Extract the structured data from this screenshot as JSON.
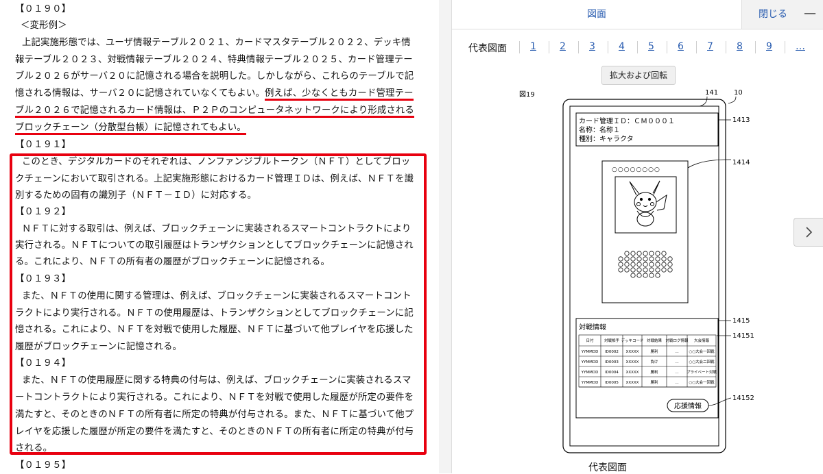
{
  "paragraphs": {
    "p0190": "【０１９０】",
    "p0190_head": "＜変形例＞",
    "p0190_l1": "上記実施形態では、ユーザ情報テーブル２０２１、カードマスタテーブル２０２２、デッキ情",
    "p0190_l2": "報テーブル２０２３、対戦情報テーブル２０２４、特典情報テーブル２０２５、カード管理テー",
    "p0190_l3": "ブル２０２６がサーバ２０に記憶される場合を説明した。しかしながら、これらのテーブルで記",
    "p0190_l4a": "憶される情報は、サーバ２０に記憶されていなくてもよい。",
    "p0190_l4b": "例えば、少なくともカード管理テー",
    "p0190_l5": "ブル２０２６で記憶されるカード情報は、Ｐ２Ｐのコンピュータネットワークにより形成される",
    "p0190_l6": "ブロックチェーン（分散型台帳）に記憶されてもよい。",
    "p0191": "【０１９１】",
    "p0191_l1": "このとき、デジタルカードのそれぞれは、ノンファンジブルトークン（ＮＦＴ）としてブロッ",
    "p0191_l2": "クチェーンにおいて取引される。上記実施形態におけるカード管理ＩＤは、例えば、ＮＦＴを識",
    "p0191_l3": "別するための固有の識別子（ＮＦＴ－ＩＤ）に対応する。",
    "p0192": "【０１９２】",
    "p0192_l1": "ＮＦＴに対する取引は、例えば、ブロックチェーンに実装されるスマートコントラクトにより",
    "p0192_l2": "実行される。ＮＦＴについての取引履歴はトランザクションとしてブロックチェーンに記憶され",
    "p0192_l3": "る。これにより、ＮＦＴの所有者の履歴がブロックチェーンに記憶される。",
    "p0193": "【０１９３】",
    "p0193_l1": "また、ＮＦＴの使用に関する管理は、例えば、ブロックチェーンに実装されるスマートコント",
    "p0193_l2": "ラクトにより実行される。ＮＦＴの使用履歴は、トランザクションとしてブロックチェーンに記",
    "p0193_l3": "憶される。これにより、ＮＦＴを対戦で使用した履歴、ＮＦＴに基づいて他プレイヤを応援した",
    "p0193_l4": "履歴がブロックチェーンに記憶される。",
    "p0194": "【０１９４】",
    "p0194_l1": "また、ＮＦＴの使用履歴に関する特典の付与は、例えば、ブロックチェーンに実装されるスマ",
    "p0194_l2": "ートコントラクトにより実行される。これにより、ＮＦＴを対戦で使用した履歴が所定の要件を",
    "p0194_l3": "満たすと、そのときのＮＦＴの所有者に所定の特典が付与される。また、ＮＦＴに基づいて他プ",
    "p0194_l4": "レイヤを応援した履歴が所定の要件を満たすと、そのときのＮＦＴの所有者に所定の特典が付与",
    "p0194_l5": "される。",
    "p0195": "【０１９５】"
  },
  "panel": {
    "title": "図面",
    "close_label": "閉じる",
    "minimize_label": "—",
    "representative_label": "代表図面",
    "pages": [
      "1",
      "2",
      "3",
      "4",
      "5",
      "6",
      "7",
      "8",
      "9",
      "…"
    ],
    "zoom_button": "拡大および回転",
    "caption": "代表図面",
    "next_icon": "chevron-right-icon"
  },
  "figure": {
    "fig_label": "図19",
    "ref_141": "141",
    "ref_10": "10",
    "ref_1413": "1413",
    "ref_1414": "1414",
    "ref_1415": "1415",
    "ref_14151": "14151",
    "ref_14152": "14152",
    "card_id": "カード管理ＩＤ：ＣＭ０００１",
    "card_name": "名称：名称１",
    "card_type": "種別：キャラクタ",
    "circles_top": "○○○○○○○○",
    "battle_title": "対戦情報",
    "table_headers": [
      "日付",
      "対戦相手",
      "デッキコード",
      "対戦結果",
      "対戦ログ情報",
      "大会情報"
    ],
    "rows": [
      [
        "YYMMDD",
        "ID0002",
        "XXXXX",
        "勝利",
        "…",
        "○○大会一回戦"
      ],
      [
        "YYMMDD",
        "ID0003",
        "XXXXX",
        "負け",
        "…",
        "○○大会二回戦"
      ],
      [
        "YYMMDD",
        "ID0004",
        "XXXXX",
        "勝利",
        "…",
        "プライベート対戦"
      ],
      [
        "YYMMDD",
        "ID0005",
        "XXXXX",
        "勝利",
        "…",
        "○○大会一回戦"
      ]
    ],
    "support_button": "応援情報"
  }
}
